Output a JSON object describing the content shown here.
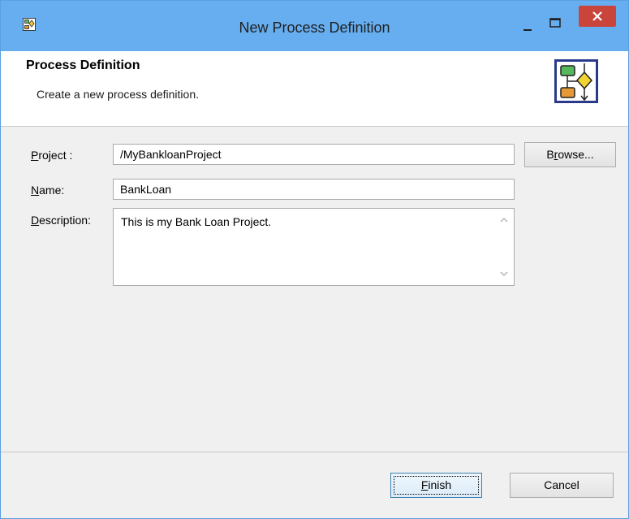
{
  "window": {
    "title": "New Process Definition",
    "controls": {
      "minimize_icon": "minimize-icon",
      "maximize_icon": "maximize-icon",
      "close_icon": "close-icon"
    }
  },
  "header": {
    "title": "Process Definition",
    "description": "Create a new process definition.",
    "icon": "process-definition-icon"
  },
  "form": {
    "project": {
      "label_pre": "",
      "label_mnemonic": "P",
      "label_post": "roject :",
      "value": "/MyBankloanProject"
    },
    "name": {
      "label_pre": "",
      "label_mnemonic": "N",
      "label_post": "ame:",
      "value": "BankLoan"
    },
    "description": {
      "label_pre": "",
      "label_mnemonic": "D",
      "label_post": "escription:",
      "value": "This is my Bank Loan Project."
    },
    "browse": {
      "label_pre": "B",
      "label_mnemonic": "r",
      "label_post": "owse..."
    }
  },
  "footer": {
    "finish": {
      "label_pre": "",
      "label_mnemonic": "F",
      "label_post": "inish"
    },
    "cancel": {
      "label": "Cancel"
    }
  },
  "colors": {
    "titlebar": "#67aef0",
    "close_button": "#c9453b",
    "dialog_bg": "#f0f0f0"
  }
}
